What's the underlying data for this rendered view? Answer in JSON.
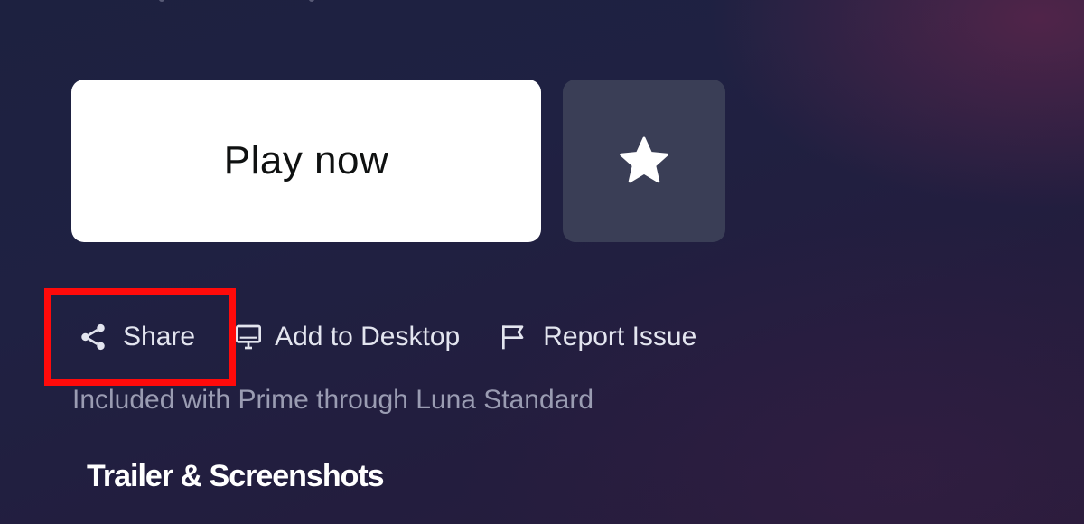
{
  "hero": {
    "play_label": "Play now",
    "favorite_icon": "star-icon"
  },
  "actions": [
    {
      "label": "Share",
      "icon": "share-icon"
    },
    {
      "label": "Add to Desktop",
      "icon": "desktop-icon"
    },
    {
      "label": "Report Issue",
      "icon": "flag-icon"
    }
  ],
  "subscription_note": "Included with Prime through Luna Standard",
  "section": {
    "title": "Trailer & Screenshots"
  },
  "colors": {
    "play_button_bg": "#ffffff",
    "favorite_button_bg": "#3a3e56",
    "highlight": "#ff0a0a",
    "muted_text": "#9a9cb2"
  }
}
